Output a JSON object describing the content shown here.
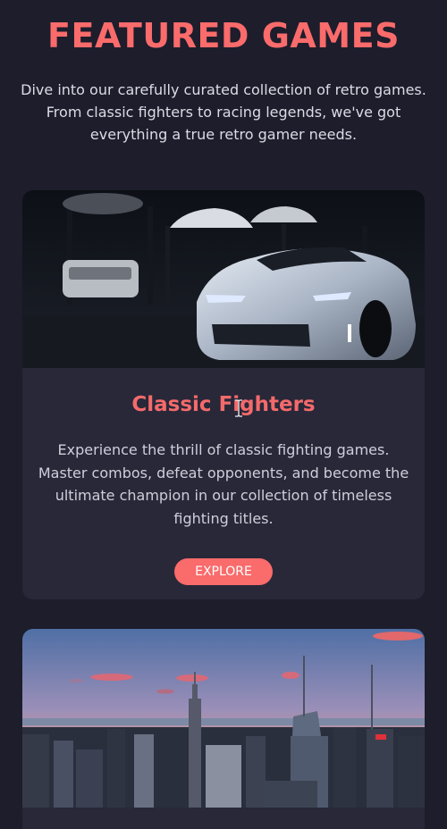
{
  "section": {
    "title": "FEATURED GAMES",
    "intro": "Dive into our carefully curated collection of retro games. From classic fighters to racing legends, we've got everything a true retro gamer needs."
  },
  "cards": [
    {
      "image": "sports-car-garage-photo",
      "title": "Classic Fighters",
      "description": "Experience the thrill of classic fighting games. Master combos, defeat opponents, and become the ultimate champion in our collection of timeless fighting titles.",
      "button_label": "EXPLORE"
    },
    {
      "image": "city-skyline-sunset-photo"
    }
  ],
  "colors": {
    "accent": "#fa6b6b",
    "background": "#1d1d2c",
    "card": "#282839"
  },
  "icons": {
    "cursor": "text-cursor-icon"
  }
}
